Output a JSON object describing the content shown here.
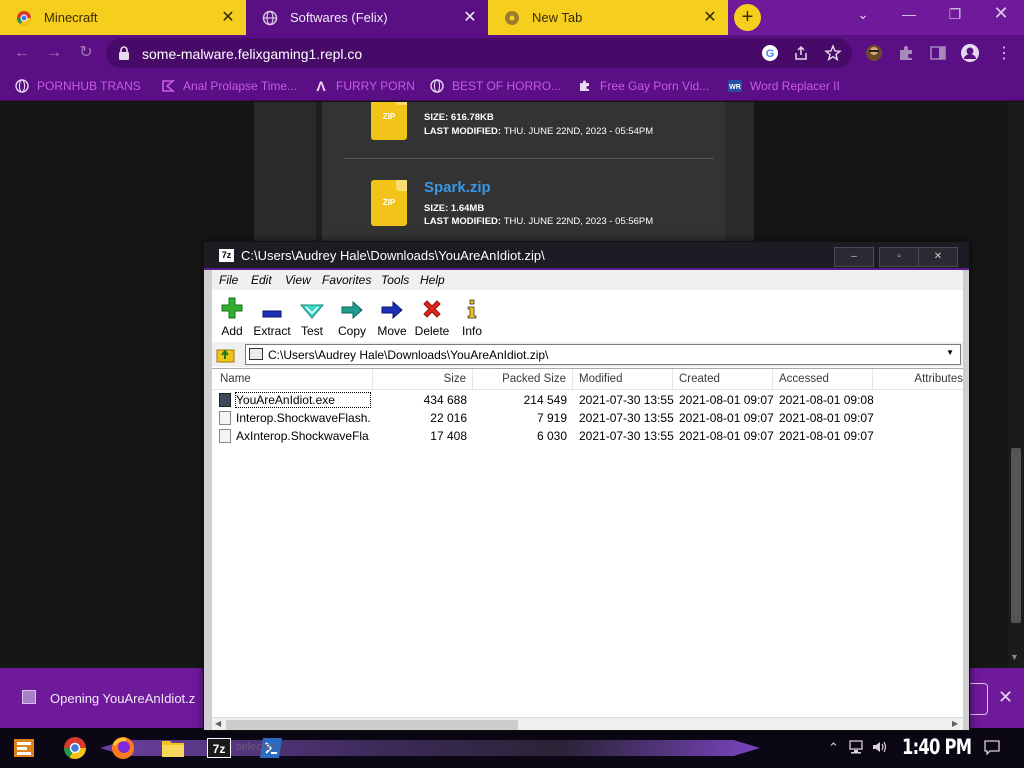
{
  "browser": {
    "tabs": [
      {
        "title": "Minecraft",
        "active": false,
        "close": "✕"
      },
      {
        "title": "Softwares (Felix)",
        "active": true,
        "close": "✕"
      },
      {
        "title": "New Tab",
        "active": false,
        "close": "✕"
      }
    ],
    "new_tab": "+",
    "url": "some-malware.felixgaming1.repl.co",
    "bookmarks": [
      {
        "label": "PORNHUB TRANS",
        "icon": "globe-icon"
      },
      {
        "label": "Anal Prolapse Time...",
        "icon": "tag-icon"
      },
      {
        "label": "FURRY PORN",
        "icon": "lambda-icon"
      },
      {
        "label": "BEST OF HORRO...",
        "icon": "globe-icon"
      },
      {
        "label": "Free Gay Porn Vid...",
        "icon": "puzzle-icon"
      },
      {
        "label": "Word Replacer II",
        "icon": "wr-icon"
      }
    ]
  },
  "page": {
    "file1": {
      "zip_label": "ZIP",
      "size_label": "SIZE:",
      "size": "616.78KB",
      "modified_label": "LAST MODIFIED:",
      "modified": "THU. JUNE 22ND, 2023 - 05:54PM"
    },
    "file2": {
      "name": "Spark.zip",
      "zip_label": "ZIP",
      "size_label": "SIZE:",
      "size": "1.64MB",
      "modified_label": "LAST MODIFIED:",
      "modified": "THU. JUNE 22ND, 2023 - 05:56PM"
    }
  },
  "download_bar": {
    "text": "Opening YouAreAnIdiot.z",
    "close": "✕"
  },
  "zip_window": {
    "title": "C:\\Users\\Audrey Hale\\Downloads\\YouAreAnIdiot.zip\\",
    "title_icon": "7z",
    "menu": [
      "File",
      "Edit",
      "View",
      "Favorites",
      "Tools",
      "Help"
    ],
    "toolbar": [
      {
        "label": "Add",
        "icon": "add-icon"
      },
      {
        "label": "Extract",
        "icon": "extract-icon"
      },
      {
        "label": "Test",
        "icon": "test-icon"
      },
      {
        "label": "Copy",
        "icon": "copy-icon"
      },
      {
        "label": "Move",
        "icon": "move-icon"
      },
      {
        "label": "Delete",
        "icon": "delete-icon"
      },
      {
        "label": "Info",
        "icon": "info-icon"
      }
    ],
    "address": "C:\\Users\\Audrey Hale\\Downloads\\YouAreAnIdiot.zip\\",
    "columns": [
      "Name",
      "Size",
      "Packed Size",
      "Modified",
      "Created",
      "Accessed",
      "Attributes"
    ],
    "rows": [
      {
        "name": "YouAreAnIdiot.exe",
        "size": "434 688",
        "packed": "214 549",
        "modified": "2021-07-30 13:55",
        "created": "2021-08-01 09:07",
        "accessed": "2021-08-01 09:08",
        "selected": true
      },
      {
        "name": "Interop.ShockwaveFlash...",
        "size": "22 016",
        "packed": "7 919",
        "modified": "2021-07-30 13:55",
        "created": "2021-08-01 09:07",
        "accessed": "2021-08-01 09:07",
        "selected": false
      },
      {
        "name": "AxInterop.ShockwaveFla...",
        "size": "17 408",
        "packed": "6 030",
        "modified": "2021-07-30 13:55",
        "created": "2021-08-01 09:07",
        "accessed": "2021-08-01 09:07",
        "selected": false
      }
    ]
  },
  "taskbar": {
    "apps": [
      "start-icon",
      "chrome-icon",
      "firefox-icon",
      "file-explorer-icon",
      "7zip-icon",
      "powershell-icon"
    ],
    "seven_zip_label": "7z",
    "status": "selected",
    "clock": "1:40 PM"
  },
  "colors": {
    "chrome_purple": "#5a0f84",
    "tab_yellow": "#f6cf1e",
    "bookmark_text": "#c75be6",
    "link_blue": "#3a97e8"
  }
}
